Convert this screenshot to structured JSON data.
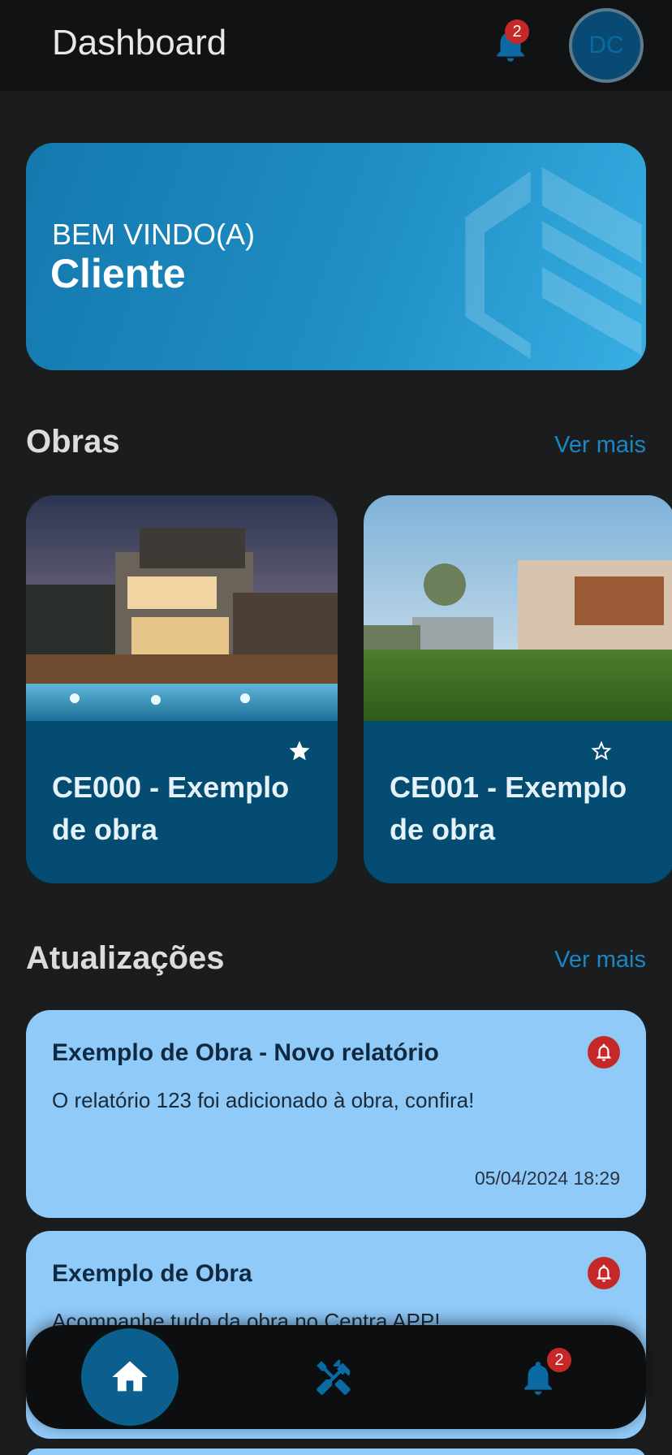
{
  "header": {
    "title": "Dashboard",
    "notification_count": "2",
    "avatar_initials": "DC"
  },
  "welcome": {
    "greeting": "BEM VINDO(A)",
    "name": "Cliente"
  },
  "obras": {
    "section_title": "Obras",
    "see_more": "Ver mais",
    "items": [
      {
        "name": "CE000 - Exemplo de obra",
        "favorite": true
      },
      {
        "name": "CE001 - Exemplo de obra",
        "favorite": false
      }
    ]
  },
  "updates": {
    "section_title": "Atualizações",
    "see_more": "Ver mais",
    "items": [
      {
        "title": "Exemplo de Obra  - Novo relatório",
        "body": "O relatório 123 foi adicionado à obra, confira!",
        "date": "05/04/2024 18:29"
      },
      {
        "title": "Exemplo de Obra",
        "body": "Acompanhe tudo da obra no Centra APP!"
      }
    ]
  },
  "bottom_nav": {
    "notification_count": "2"
  },
  "colors": {
    "background": "#1b1c1e",
    "header": "#111214",
    "accent": "#1a86c4",
    "card_dark": "#054c73",
    "card_light": "#90caf9",
    "alert": "#c62828"
  },
  "icons": [
    "bell-icon",
    "home-icon",
    "tools-icon",
    "star-filled-icon",
    "star-outline-icon",
    "alert-bell-icon"
  ]
}
